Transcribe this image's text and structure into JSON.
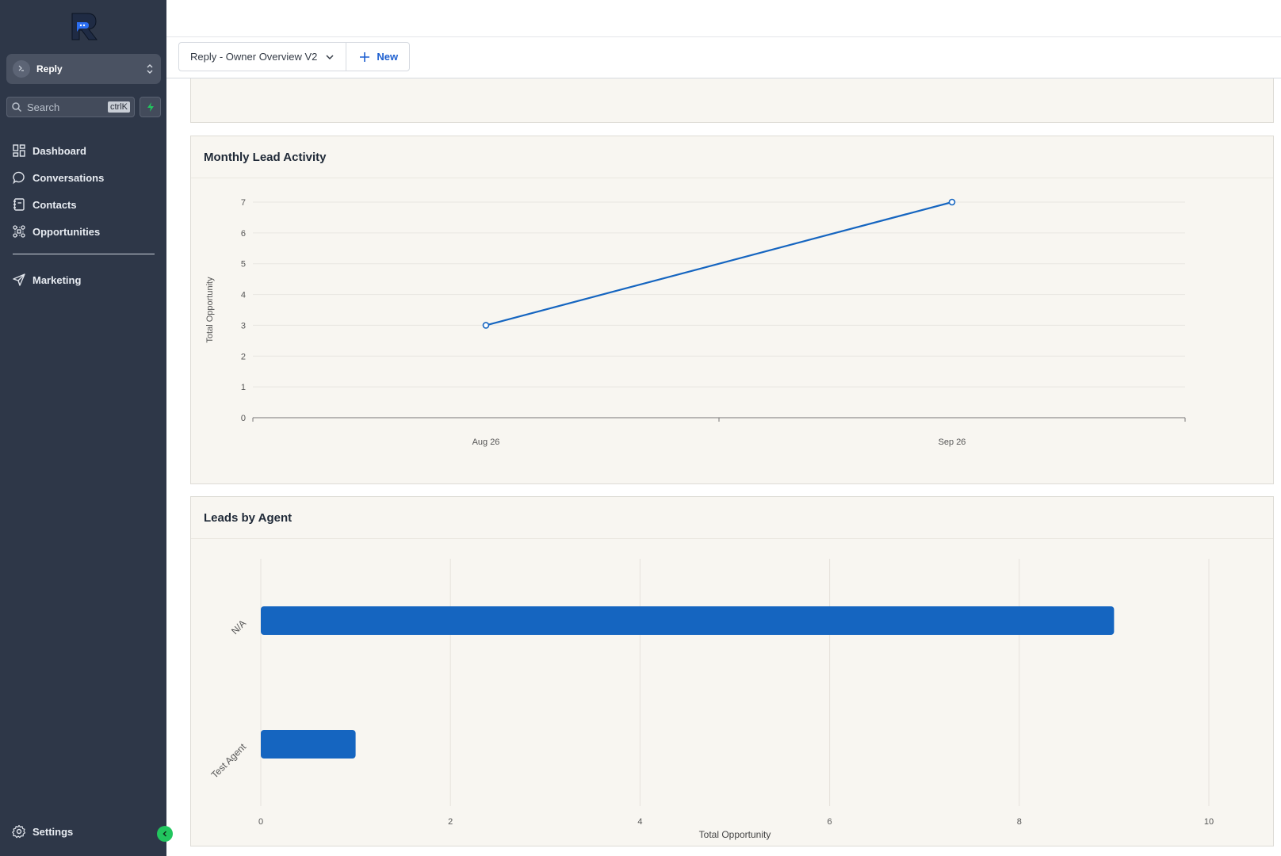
{
  "sidebar": {
    "account_name": "Reply",
    "search_placeholder": "Search",
    "search_shortcut": "ctrlK",
    "nav_items": [
      {
        "label": "Dashboard",
        "icon": "dashboard-icon"
      },
      {
        "label": "Conversations",
        "icon": "chat-icon"
      },
      {
        "label": "Contacts",
        "icon": "contacts-icon"
      },
      {
        "label": "Opportunities",
        "icon": "opportunities-icon"
      }
    ],
    "nav_items_2": [
      {
        "label": "Marketing",
        "icon": "send-icon"
      }
    ],
    "settings_label": "Settings"
  },
  "toolbar": {
    "dashboard_select": "Reply - Owner Overview V2",
    "new_label": "New"
  },
  "colors": {
    "sidebar_bg": "#2e3748",
    "accent": "#1565c0",
    "panel_bg": "#f8f6f1",
    "green": "#22c55e"
  },
  "panels": {
    "monthly_title": "Monthly Lead Activity",
    "agent_title": "Leads by Agent"
  },
  "chart_data": [
    {
      "type": "line",
      "title": "Monthly Lead Activity",
      "xlabel": "",
      "ylabel": "Total Opportunity",
      "x": [
        "Aug 26",
        "Sep 26"
      ],
      "series": [
        {
          "values": [
            3,
            7
          ]
        }
      ],
      "ylim": [
        0,
        7
      ],
      "yticks": [
        "0",
        "1",
        "2",
        "3",
        "4",
        "5",
        "6",
        "7"
      ],
      "grid": true
    },
    {
      "type": "bar",
      "orientation": "horizontal",
      "title": "Leads by Agent",
      "categories": [
        "N/A",
        "Test Agent"
      ],
      "values": [
        9,
        1
      ],
      "xlabel": "Total Opportunity",
      "ylabel": "",
      "xlim": [
        0,
        10
      ],
      "xticks": [
        "0",
        "2",
        "4",
        "6",
        "8",
        "10"
      ],
      "grid": true
    }
  ]
}
